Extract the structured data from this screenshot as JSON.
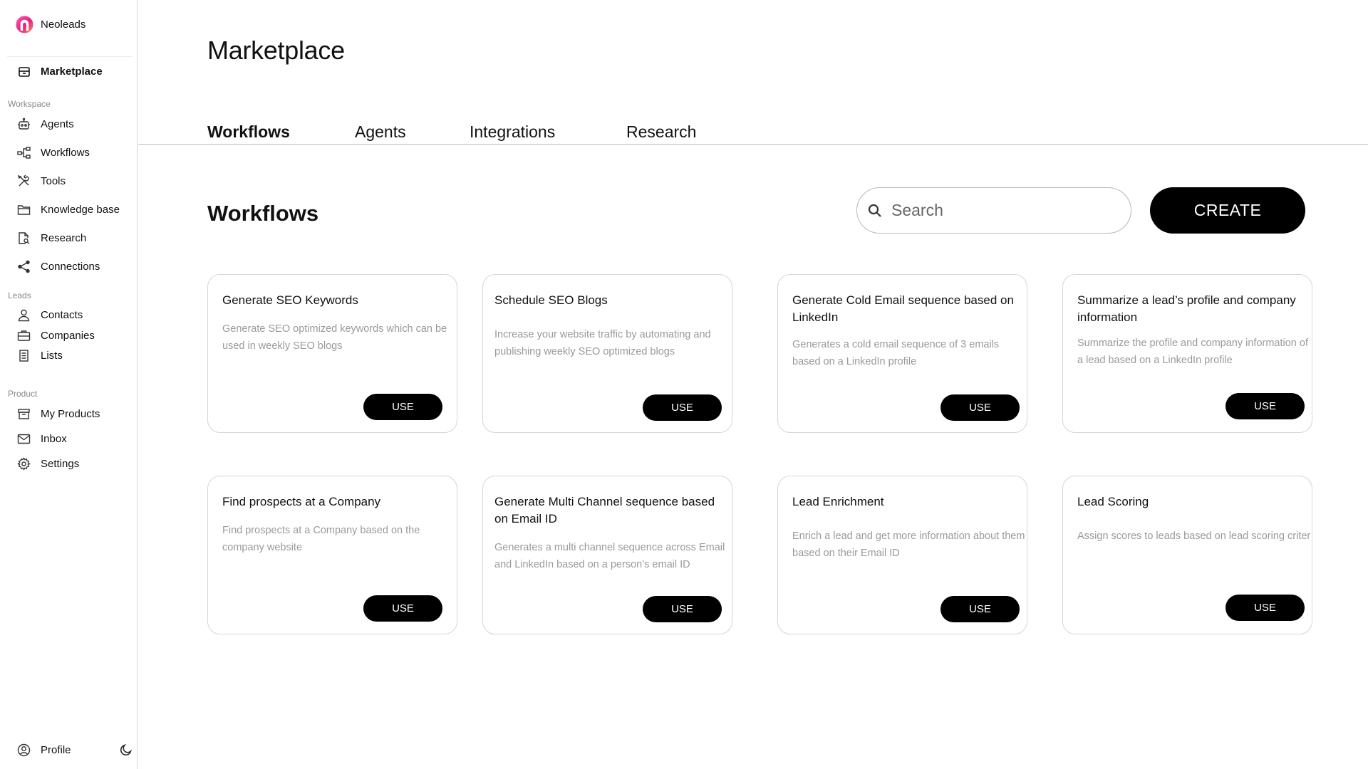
{
  "brand": {
    "name": "Neoleads"
  },
  "sidebar": {
    "top_item": {
      "label": "Marketplace",
      "icon": "store-icon"
    },
    "sections": [
      {
        "label": "Workspace",
        "items": [
          {
            "label": "Agents",
            "icon": "robot-icon"
          },
          {
            "label": "Workflows",
            "icon": "workflow-icon"
          },
          {
            "label": "Tools",
            "icon": "tools-icon"
          },
          {
            "label": "Knowledge base",
            "icon": "folder-icon"
          },
          {
            "label": "Research",
            "icon": "document-search-icon"
          },
          {
            "label": "Connections",
            "icon": "share-icon"
          }
        ]
      },
      {
        "label": "Leads",
        "items": [
          {
            "label": "Contacts",
            "icon": "person-icon"
          },
          {
            "label": "Companies",
            "icon": "briefcase-icon"
          },
          {
            "label": "Lists",
            "icon": "list-icon"
          }
        ]
      },
      {
        "label": "Product",
        "items": [
          {
            "label": "My Products",
            "icon": "box-icon"
          },
          {
            "label": "Inbox",
            "icon": "mail-icon"
          },
          {
            "label": "Settings",
            "icon": "gear-icon"
          }
        ]
      }
    ],
    "profile": {
      "label": "Profile",
      "icon": "user-circle-icon"
    },
    "theme_toggle_icon": "moon-icon"
  },
  "main": {
    "title": "Marketplace",
    "tabs": [
      {
        "label": "Workflows",
        "active": true
      },
      {
        "label": "Agents",
        "active": false
      },
      {
        "label": "Integrations",
        "active": false
      },
      {
        "label": "Research",
        "active": false
      }
    ],
    "section_title": "Workflows",
    "search": {
      "placeholder": "Search",
      "value": ""
    },
    "create_label": "CREATE",
    "cards": [
      {
        "title": "Generate SEO Keywords",
        "description": "Generate SEO optimized keywords which can be used in weekly SEO blogs",
        "button": "USE"
      },
      {
        "title": "Schedule SEO Blogs",
        "description": "Increase your website traffic by automating and publishing weekly SEO optimized blogs",
        "button": "USE"
      },
      {
        "title": "Generate Cold Email sequence based on LinkedIn",
        "description": "Generates a cold email sequence of 3 emails based on a LinkedIn profile",
        "button": "USE"
      },
      {
        "title": "Summarize a lead’s profile and company information",
        "description": "Summarize the profile and company information of a lead  based on a LinkedIn profile",
        "button": "USE"
      },
      {
        "title": "Find prospects at a Company",
        "description": "Find prospects at a Company based on the company website",
        "button": "USE"
      },
      {
        "title": "Generate Multi Channel sequence based on Email ID",
        "description": "Generates a multi channel sequence across Email and LinkedIn based on a person’s email ID",
        "button": "USE"
      },
      {
        "title": "Lead Enrichment",
        "description": "Enrich a lead and get more information about them based on their Email ID",
        "button": "USE"
      },
      {
        "title": "Lead Scoring",
        "description": "Assign scores to leads based on lead scoring criteria",
        "button": "USE"
      }
    ]
  }
}
